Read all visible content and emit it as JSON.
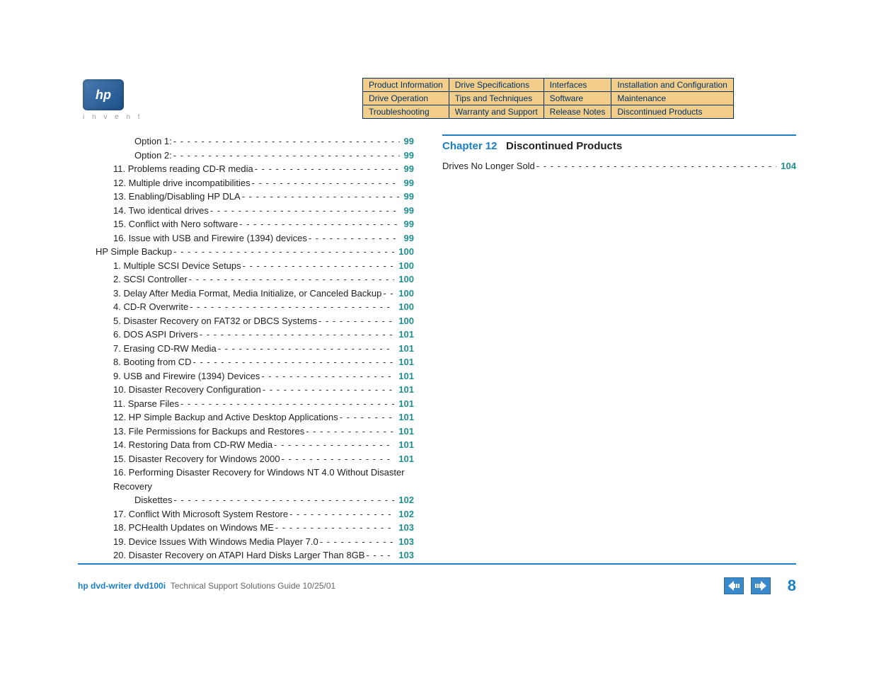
{
  "logo": {
    "label": "hp",
    "sub": "i n v e n t"
  },
  "nav": {
    "rows": [
      [
        "Product Information",
        "Drive Specifications",
        "Interfaces",
        "Installation and Configuration"
      ],
      [
        "Drive Operation",
        "Tips and Techniques",
        "Software",
        "Maintenance"
      ],
      [
        "Troubleshooting",
        "Warranty and Support",
        "Release Notes",
        "Discontinued Products"
      ]
    ]
  },
  "toc_left": [
    {
      "indent": 3,
      "text": "Option 1:",
      "page": "99"
    },
    {
      "indent": 3,
      "text": "Option 2:",
      "page": "99"
    },
    {
      "indent": 2,
      "text": "11. Problems reading CD-R media",
      "page": "99"
    },
    {
      "indent": 2,
      "text": "12. Multiple drive incompatibilities",
      "page": "99"
    },
    {
      "indent": 2,
      "text": "13. Enabling/Disabling HP DLA",
      "page": "99"
    },
    {
      "indent": 2,
      "text": "14. Two identical drives",
      "page": "99"
    },
    {
      "indent": 2,
      "text": "15. Conflict with Nero software",
      "page": "99"
    },
    {
      "indent": 2,
      "text": "16. Issue with USB and Firewire (1394) devices",
      "page": "99"
    },
    {
      "indent": 1,
      "text": "HP Simple Backup",
      "page": "100"
    },
    {
      "indent": 2,
      "text": "1. Multiple SCSI Device Setups",
      "page": "100"
    },
    {
      "indent": 2,
      "text": "2. SCSI Controller",
      "page": "100"
    },
    {
      "indent": 2,
      "text": "3. Delay After Media Format, Media Initialize, or Canceled Backup",
      "page": "100"
    },
    {
      "indent": 2,
      "text": "4. CD-R Overwrite",
      "page": "100"
    },
    {
      "indent": 2,
      "text": "5. Disaster Recovery on FAT32 or DBCS Systems",
      "page": "100"
    },
    {
      "indent": 2,
      "text": "6. DOS ASPI Drivers",
      "page": "101"
    },
    {
      "indent": 2,
      "text": "7. Erasing CD-RW Media",
      "page": "101"
    },
    {
      "indent": 2,
      "text": "8. Booting from CD",
      "page": "101"
    },
    {
      "indent": 2,
      "text": "9. USB and Firewire (1394) Devices",
      "page": "101"
    },
    {
      "indent": 2,
      "text": "10. Disaster Recovery Configuration",
      "page": "101"
    },
    {
      "indent": 2,
      "text": "11. Sparse Files",
      "page": "101"
    },
    {
      "indent": 2,
      "text": "12. HP Simple Backup and Active Desktop Applications",
      "page": "101"
    },
    {
      "indent": 2,
      "text": "13. File Permissions for Backups and Restores",
      "page": "101"
    },
    {
      "indent": 2,
      "text": "14. Restoring Data from CD-RW Media",
      "page": "101"
    },
    {
      "indent": 2,
      "text": "15. Disaster Recovery for Windows 2000",
      "page": "101"
    },
    {
      "indent": 2,
      "text": "16. Performing Disaster Recovery for Windows NT 4.0 Without Disaster Recovery",
      "wrap": true,
      "subtext": "Diskettes",
      "page": "102"
    },
    {
      "indent": 2,
      "text": "17. Conflict With Microsoft System Restore",
      "page": "102"
    },
    {
      "indent": 2,
      "text": "18. PCHealth Updates on Windows ME",
      "page": "103"
    },
    {
      "indent": 2,
      "text": "19. Device Issues With Windows Media Player 7.0",
      "page": "103"
    },
    {
      "indent": 2,
      "text": "20. Disaster Recovery on ATAPI Hard Disks Larger Than 8GB",
      "page": "103"
    }
  ],
  "right": {
    "chapter_num": "Chapter 12",
    "chapter_title": "Discontinued Products",
    "entries": [
      {
        "text": "Drives No Longer Sold",
        "page": "104"
      }
    ]
  },
  "footer": {
    "product": "hp dvd-writer  dvd100i",
    "subtitle": "Technical Support Solutions Guide 10/25/01",
    "page": "8"
  }
}
